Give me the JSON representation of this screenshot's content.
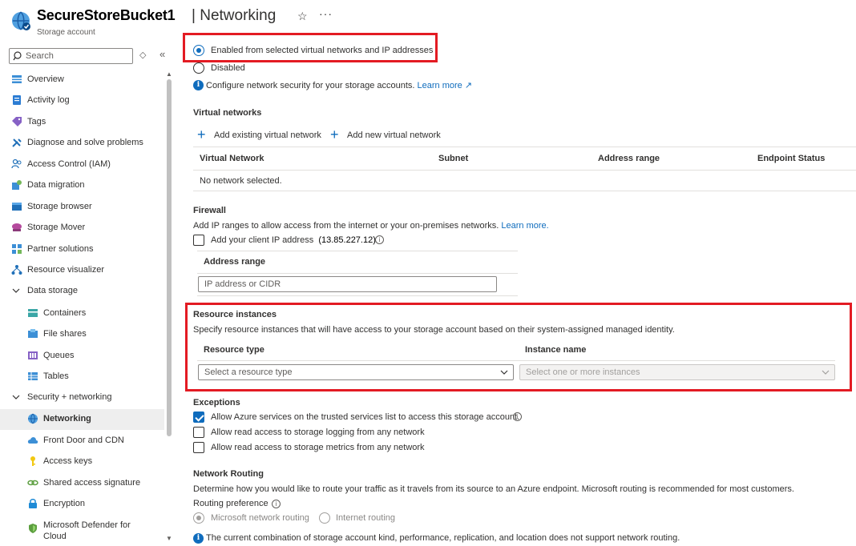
{
  "header": {
    "title": "SecureStoreBucket1",
    "separator": "|",
    "page": "Networking",
    "subtitle": "Storage account",
    "star": "☆",
    "more": "···"
  },
  "sidebar": {
    "search_placeholder": "Search",
    "items": [
      {
        "label": "Overview",
        "icon": "overview-icon"
      },
      {
        "label": "Activity log",
        "icon": "activity-log-icon"
      },
      {
        "label": "Tags",
        "icon": "tag-icon"
      },
      {
        "label": "Diagnose and solve problems",
        "icon": "wrench-icon"
      },
      {
        "label": "Access Control (IAM)",
        "icon": "people-icon"
      },
      {
        "label": "Data migration",
        "icon": "data-migration-icon"
      },
      {
        "label": "Storage browser",
        "icon": "storage-browser-icon"
      },
      {
        "label": "Storage Mover",
        "icon": "storage-mover-icon"
      },
      {
        "label": "Partner solutions",
        "icon": "partner-icon"
      },
      {
        "label": "Resource visualizer",
        "icon": "hierarchy-icon"
      },
      {
        "label": "Data storage",
        "icon": "chevron-down-icon"
      },
      {
        "label": "Containers",
        "icon": "containers-icon"
      },
      {
        "label": "File shares",
        "icon": "file-shares-icon"
      },
      {
        "label": "Queues",
        "icon": "queues-icon"
      },
      {
        "label": "Tables",
        "icon": "tables-icon"
      },
      {
        "label": "Security + networking",
        "icon": "chevron-down-icon"
      },
      {
        "label": "Networking",
        "icon": "networking-icon"
      },
      {
        "label": "Front Door and CDN",
        "icon": "cloud-icon"
      },
      {
        "label": "Access keys",
        "icon": "key-icon"
      },
      {
        "label": "Shared access signature",
        "icon": "link-icon"
      },
      {
        "label": "Encryption",
        "icon": "lock-icon"
      },
      {
        "label": "Microsoft Defender for",
        "label2": "Cloud",
        "icon": "shield-icon"
      }
    ]
  },
  "access": {
    "enabled_selected": "Enabled from selected virtual networks and IP addresses",
    "disabled": "Disabled",
    "info_text": "Configure network security for your storage accounts.",
    "learn_more": "Learn more"
  },
  "vnets": {
    "heading": "Virtual networks",
    "add_existing": "Add existing virtual network",
    "add_new": "Add new virtual network",
    "columns": [
      "Virtual Network",
      "Subnet",
      "Address range",
      "Endpoint Status"
    ],
    "empty": "No network selected."
  },
  "firewall": {
    "heading": "Firewall",
    "desc": "Add IP ranges to allow access from the internet or your on-premises networks.",
    "learn_more": "Learn more.",
    "client_ip_label": "Add your client IP address",
    "client_ip_value": "(13.85.227.12)",
    "address_range_header": "Address range",
    "address_placeholder": "IP address or CIDR"
  },
  "resource_instances": {
    "heading": "Resource instances",
    "desc": "Specify resource instances that will have access to your storage account based on their system-assigned managed identity.",
    "resource_type_header": "Resource type",
    "instance_name_header": "Instance name",
    "resource_type_placeholder": "Select a resource type",
    "instance_placeholder": "Select one or more instances"
  },
  "exceptions": {
    "heading": "Exceptions",
    "items": [
      {
        "label": "Allow Azure services on the trusted services list to access this storage account.",
        "checked": true
      },
      {
        "label": "Allow read access to storage logging from any network",
        "checked": false
      },
      {
        "label": "Allow read access to storage metrics from any network",
        "checked": false
      }
    ]
  },
  "routing": {
    "heading": "Network Routing",
    "desc": "Determine how you would like to route your traffic as it travels from its source to an Azure endpoint. Microsoft routing is recommended for most customers.",
    "preference_label": "Routing preference",
    "option_microsoft": "Microsoft network routing",
    "option_internet": "Internet routing",
    "note": "The current combination of storage account kind, performance, replication, and location does not support network routing."
  },
  "colors": {
    "accent": "#0f6cbd",
    "highlight": "#e31b23"
  }
}
